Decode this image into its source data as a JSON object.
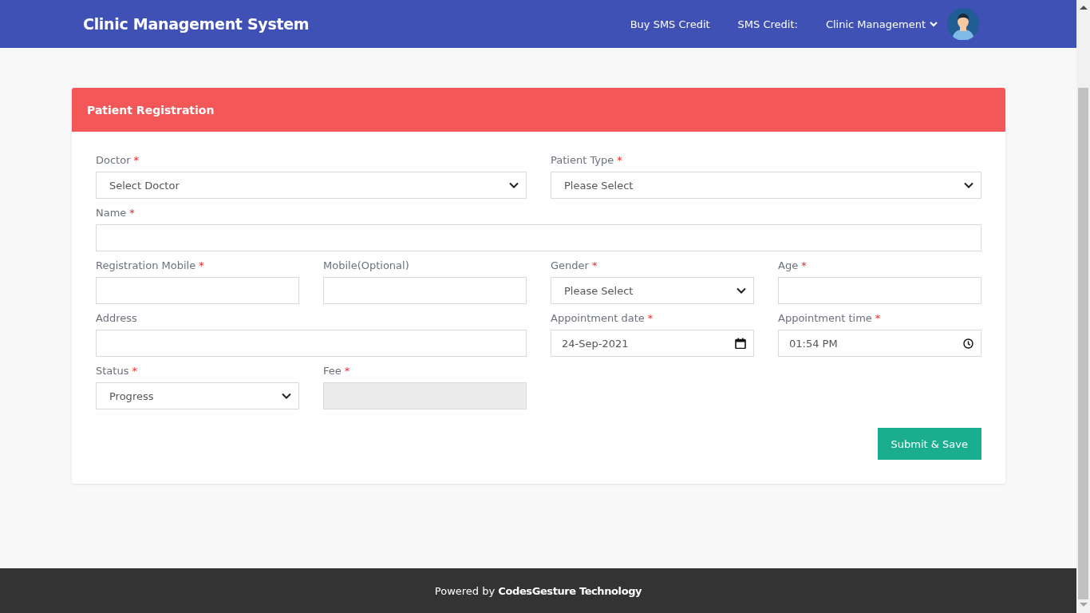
{
  "navbar": {
    "brand": "Clinic Management System",
    "links": [
      {
        "label": "Buy SMS Credit",
        "kind": "link"
      },
      {
        "label": "SMS Credit:",
        "kind": "text"
      },
      {
        "label": "Clinic Management",
        "kind": "dropdown"
      }
    ]
  },
  "card": {
    "title": "Patient Registration",
    "rows": [
      {
        "kind": "split",
        "left": [
          {
            "label": "Doctor",
            "mark": "*",
            "kind": "select",
            "value": "Select Doctor"
          }
        ],
        "right": [
          {
            "label": "Patient Type",
            "mark": "*",
            "kind": "select",
            "value": "Please Select"
          }
        ]
      },
      {
        "kind": "full",
        "fields": [
          {
            "label": "Name",
            "mark": "*",
            "kind": "text"
          }
        ]
      },
      {
        "kind": "split",
        "left": [
          {
            "label": "Registration Mobile",
            "mark": "*",
            "kind": "text"
          },
          {
            "label": "Mobile(Optional)",
            "kind": "text"
          }
        ],
        "right": [
          {
            "label": "Gender",
            "mark": "*",
            "kind": "select",
            "value": "Please Select"
          },
          {
            "label": "Age",
            "mark": "*",
            "kind": "text"
          }
        ]
      },
      {
        "kind": "split",
        "left": [
          {
            "label": "Address",
            "kind": "text"
          }
        ],
        "right": [
          {
            "label": "Appointment date",
            "mark": "*",
            "kind": "date",
            "value": "24-Sep-2021"
          },
          {
            "label": "Appointment time",
            "mark": "*",
            "kind": "time",
            "value": "01:54 PM"
          }
        ]
      },
      {
        "kind": "split",
        "left": [
          {
            "label": "Status",
            "mark": "*",
            "kind": "select",
            "value": "Progress"
          },
          {
            "label": "Fee",
            "mark": "*",
            "kind": "text",
            "disabled": true
          }
        ]
      }
    ],
    "submit": "Submit & Save"
  },
  "footer": {
    "prefix": "Powered by",
    "company": "CodesGesture Technology"
  }
}
